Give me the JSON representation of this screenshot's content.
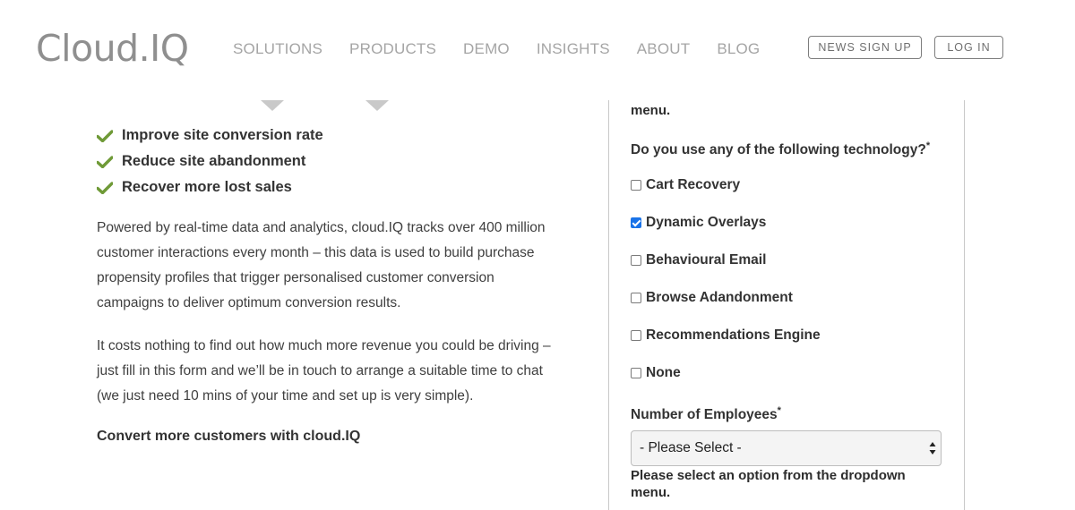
{
  "header": {
    "logo_text": "Cloud.IQ",
    "nav": [
      "SOLUTIONS",
      "PRODUCTS",
      "DEMO",
      "INSIGHTS",
      "ABOUT",
      "BLOG"
    ],
    "news_signup_label": "NEWS SIGN UP",
    "login_label": "LOG IN"
  },
  "main": {
    "benefits": [
      "Improve site conversion rate",
      "Reduce site abandonment",
      "Recover more lost sales"
    ],
    "paragraph_1": "Powered by real-time data and analytics, cloud.IQ tracks over 400 million customer interactions every month – this data is used to build purchase propensity profiles that trigger personalised customer conversion campaigns to deliver optimum conversion results.",
    "paragraph_2": "It costs nothing to find out how much more revenue you could be driving – just fill in this form and we’ll be in touch to arrange a suitable time to chat (we just need 10 mins of your time and set up is very simple).",
    "cta": "Convert more customers with cloud.IQ"
  },
  "form": {
    "top_error_partial": "menu.",
    "technology_question": "Do you use any of the following technology?",
    "required_mark": "*",
    "technology_options": [
      {
        "label": "Cart Recovery",
        "checked": false
      },
      {
        "label": "Dynamic Overlays",
        "checked": true
      },
      {
        "label": "Behavioural Email",
        "checked": false
      },
      {
        "label": "Browse Adandonment",
        "checked": false
      },
      {
        "label": "Recommendations Engine",
        "checked": false
      },
      {
        "label": "None",
        "checked": false
      }
    ],
    "employees_label": "Number of Employees",
    "employees_select_value": "- Please Select -",
    "employees_error": "Please select an option from the dropdown menu."
  },
  "colors": {
    "checkmark_green": "#6f9a37",
    "checkbox_checked_blue": "#1a73e8",
    "nav_grey": "#a5a5a5"
  }
}
